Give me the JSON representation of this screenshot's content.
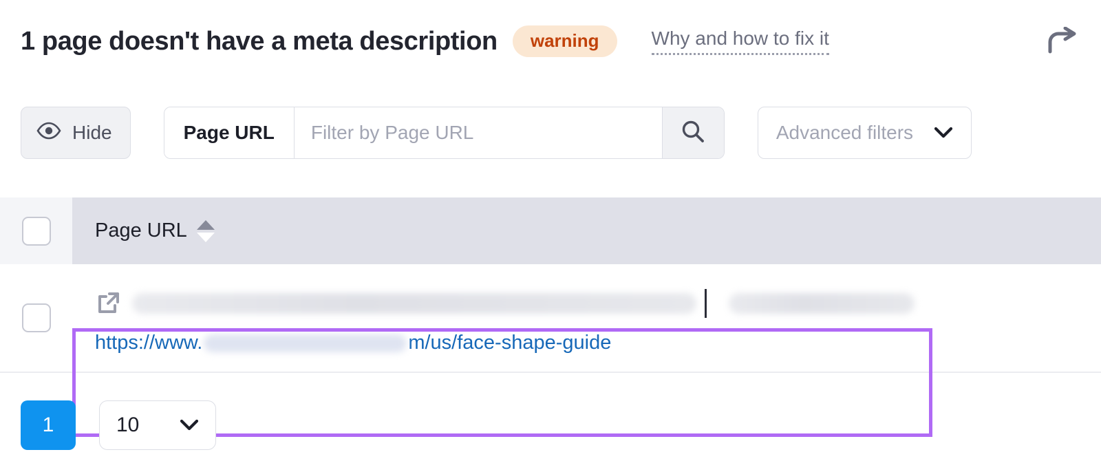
{
  "header": {
    "title": "1 page doesn't have a meta description",
    "badge": "warning",
    "fix_link": "Why and how to fix it",
    "share_icon": "share-arrow-icon",
    "badge_bg": "#fbe7d2",
    "badge_color": "#c1420a"
  },
  "toolbar": {
    "hide_label": "Hide",
    "hide_icon": "eye-icon",
    "filter_field_label": "Page URL",
    "filter_placeholder": "Filter by Page URL",
    "filter_value": "",
    "search_icon": "search-icon",
    "advanced_filters_label": "Advanced filters",
    "advanced_filters_icon": "chevron-down-icon"
  },
  "table": {
    "select_all_checked": false,
    "columns": [
      {
        "label": "Page URL",
        "sortable": true,
        "sort_icon": "sort-arrows-icon"
      }
    ],
    "rows": [
      {
        "checked": false,
        "external_link_icon": "external-link-icon",
        "title_redacted": true,
        "title_separator": "|",
        "url_prefix": "https://www.",
        "url_suffix": "m/us/face-shape-guide",
        "url_redacted": true,
        "highlighted": true,
        "highlight_color": "#b06af5"
      }
    ]
  },
  "pagination": {
    "current_page": "1",
    "per_page": "10",
    "per_page_icon": "chevron-down-icon",
    "active_color": "#0f93ef"
  }
}
